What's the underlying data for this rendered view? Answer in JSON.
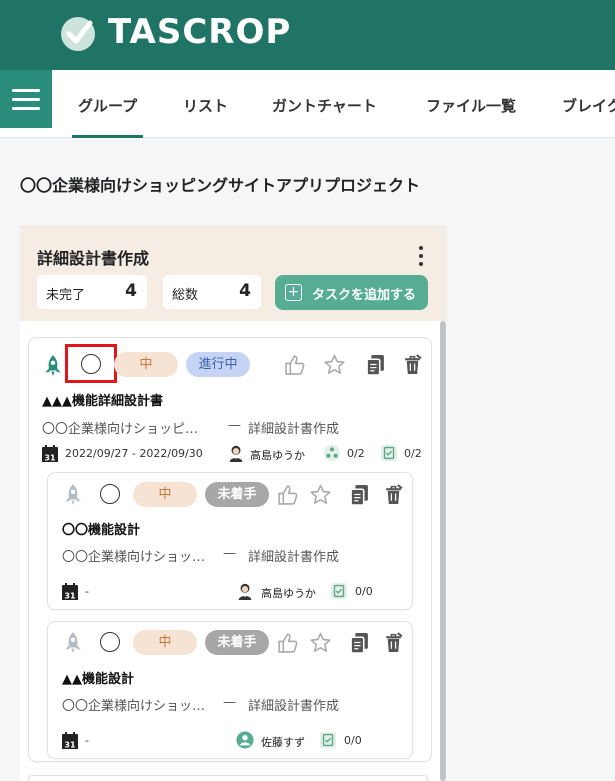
{
  "header": {
    "brand": "TASCROP"
  },
  "nav": {
    "tabs": [
      {
        "label": "グループ"
      },
      {
        "label": "リスト"
      },
      {
        "label": "ガントチャート"
      },
      {
        "label": "ファイル一覧"
      },
      {
        "label": "ブレイク"
      }
    ],
    "active": "グループ"
  },
  "project": {
    "title": "〇〇企業様向けショッピングサイトアプリプロジェクト"
  },
  "group": {
    "title": "詳細設計書作成",
    "incomplete_label": "未完了",
    "incomplete_count": "4",
    "total_label": "総数",
    "total_count": "4",
    "add_task_label": "タスクを追加する"
  },
  "tasks": [
    {
      "priority": "中",
      "status": "進行中",
      "name": "▲▲▲機能詳細設計書",
      "project": "〇〇企業様向けショッピ…",
      "separator": "—",
      "group": "詳細設計書作成",
      "date_range": "2022/09/27 - 2022/09/30",
      "assignee": "高島ゆうか",
      "subtasks": "0/2",
      "checklist": "0/2"
    },
    {
      "priority": "中",
      "status": "未着手",
      "name": "〇〇機能設計",
      "project": "〇〇企業様向けショッ…",
      "separator": "—",
      "group": "詳細設計書作成",
      "date_range": "-",
      "assignee": "高島ゆうか",
      "checklist": "0/0"
    },
    {
      "priority": "中",
      "status": "未着手",
      "name": "▲▲機能設計",
      "project": "〇〇企業様向けショッ…",
      "separator": "—",
      "group": "詳細設計書作成",
      "date_range": "-",
      "assignee": "佐藤すず",
      "checklist": "0/0"
    }
  ],
  "colors": {
    "brand": "#1f7466",
    "accent": "#56ad93",
    "priority_bg": "#f7e3d3",
    "in_progress_bg": "#c5d3f5",
    "not_started_bg": "#a7a7a7",
    "highlight": "#e0161b"
  },
  "icons": [
    "logo-check-icon",
    "menu-icon",
    "rocket-icon",
    "check-circle-icon",
    "like-icon",
    "star-icon",
    "copy-icon",
    "trash-icon",
    "calendar-icon",
    "avatar-icon",
    "subtask-icon",
    "checklist-icon",
    "kebab-icon",
    "plus-icon"
  ]
}
